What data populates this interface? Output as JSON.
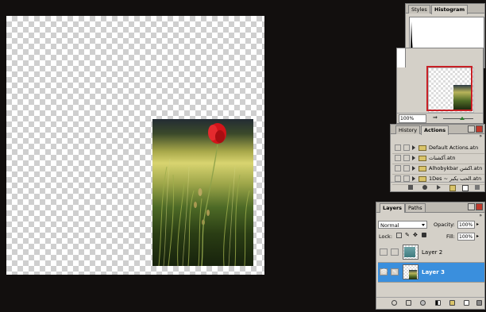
{
  "histogram": {
    "tabs": [
      "Styles",
      "Histogram"
    ],
    "active_tab": "Histogram"
  },
  "navigator": {
    "zoom": "100%"
  },
  "actions": {
    "tabs": [
      "History",
      "Actions"
    ],
    "active_tab": "Actions",
    "items": [
      {
        "label": "Default Actions.atn"
      },
      {
        "label": "آكشنات.atn"
      },
      {
        "label": "Alhobykbar اكشن.atn"
      },
      {
        "label": "1Des ~ الحب يكبر.atn"
      }
    ]
  },
  "layers": {
    "tabs": [
      "Layers",
      "Paths"
    ],
    "active_tab": "Layers",
    "blend_mode": "Normal",
    "opacity_label": "Opacity:",
    "opacity_value": "100%",
    "lock_label": "Lock:",
    "fill_label": "Fill:",
    "fill_value": "100%",
    "items": [
      {
        "name": "Layer 2",
        "selected": false
      },
      {
        "name": "Layer 3",
        "selected": true
      }
    ]
  },
  "colors": {
    "workspace": "#120f0e",
    "panel": "#d4d0c8",
    "selection": "#3a8fdd",
    "navigator_box": "#c82026",
    "poppy": "#d2141a"
  }
}
